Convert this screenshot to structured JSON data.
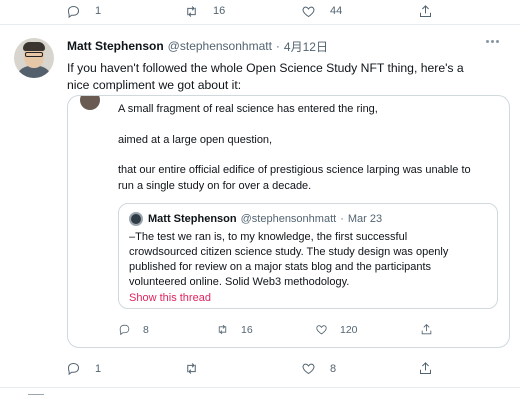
{
  "previous_tweet_actions": {
    "reply_count": "1",
    "retweet_count": "16",
    "like_count": "44"
  },
  "tweet": {
    "author_name": "Matt Stephenson",
    "author_handle": "@stephensonhmatt",
    "separator": "·",
    "date": "4月12日",
    "text_line1": "If you haven't followed the whole Open Science Study NFT thing, here's a",
    "text_line2": "nice compliment we got about it:"
  },
  "quoted_tweet": {
    "line1": "A small fragment of real science has entered the ring,",
    "line2": "aimed at a large open question,",
    "line3": "that our entire official edifice of prestigious science larping was unable to",
    "line4": "run a single study on for over a decade.",
    "inner": {
      "author_name": "Matt Stephenson",
      "author_handle": "@stephensonhmatt",
      "separator": "·",
      "date": "Mar 23",
      "text_line1": "–The test we ran is, to my knowledge, the first successful",
      "text_line2": "crowdsourced citizen science study.  The study design was openly",
      "text_line3": "published for review on a major stats blog and the participants",
      "text_line4": "volunteered online.  Solid Web3 methodology.",
      "show_thread": "Show this thread"
    },
    "actions": {
      "reply_count": "8",
      "retweet_count": "16",
      "like_count": "120"
    }
  },
  "tweet_actions": {
    "reply_count": "1",
    "like_count": "8"
  },
  "icons": {
    "reply": "reply-icon",
    "retweet": "retweet-icon",
    "like": "heart-icon",
    "share": "share-icon",
    "more": "more-icon"
  },
  "colors": {
    "link_accent": "#e0245e",
    "muted_text": "#536471",
    "border": "#cfd9de"
  }
}
